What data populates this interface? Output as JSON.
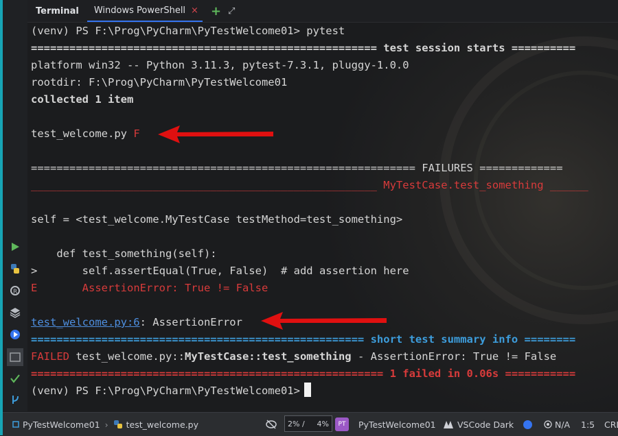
{
  "tabbar": {
    "title": "Terminal",
    "active_tab": "Windows PowerShell",
    "close_glyph": "×",
    "add_glyph": "+",
    "expand_glyph": "⤢"
  },
  "terminal": {
    "prompt_cmd": "(venv) PS F:\\Prog\\PyCharm\\PyTestWelcome01> pytest",
    "session_start": "====================================================== test session starts ==========",
    "platform": "platform win32 -- Python 3.11.3, pytest-7.3.1, pluggy-1.0.0",
    "rootdir": "rootdir: F:\\Prog\\PyCharm\\PyTestWelcome01",
    "collected": "collected 1 item",
    "test_file": "test_welcome.py ",
    "test_result": "F",
    "failures_header": "============================================================ FAILURES =============",
    "failure_name": "______________________________________________________ MyTestCase.test_something ______",
    "self_line": "self = <test_welcome.MyTestCase testMethod=test_something>",
    "def_line": "    def test_something(self):",
    "assert_marker": ">",
    "assert_code": "       self.assertEqual(True, False)  # add assertion here",
    "error_marker": "E",
    "error_text": "       AssertionError: True != False",
    "loc_link": "test_welcome.py:6",
    "loc_rest": ": AssertionError",
    "summary_header": "==================================================== short test summary info ========",
    "failed_label": "FAILED",
    "failed_file": " test_welcome.py::",
    "failed_test": "MyTestCase::test_something",
    "failed_rest": " - AssertionError: True != False",
    "final_summary": "======================================================= 1 failed in 0.06s ===========",
    "final_prompt": "(venv) PS F:\\Prog\\PyCharm\\PyTestWelcome01>"
  },
  "statusbar": {
    "project": "PyTestWelcome01",
    "separator": "›",
    "file": "test_welcome.py",
    "usage_left": "2% /",
    "usage_right": "4%",
    "badge": "PT",
    "project_name": "PyTestWelcome01",
    "theme": "VSCode Dark",
    "na": "N/A",
    "position": "1:5",
    "line_ending": "CRL"
  },
  "colors": {
    "accent_stripe": "#17a5b5",
    "error_red": "#d83b3b",
    "summary_blue": "#3d9ddc",
    "arrow_red": "#e01010"
  }
}
